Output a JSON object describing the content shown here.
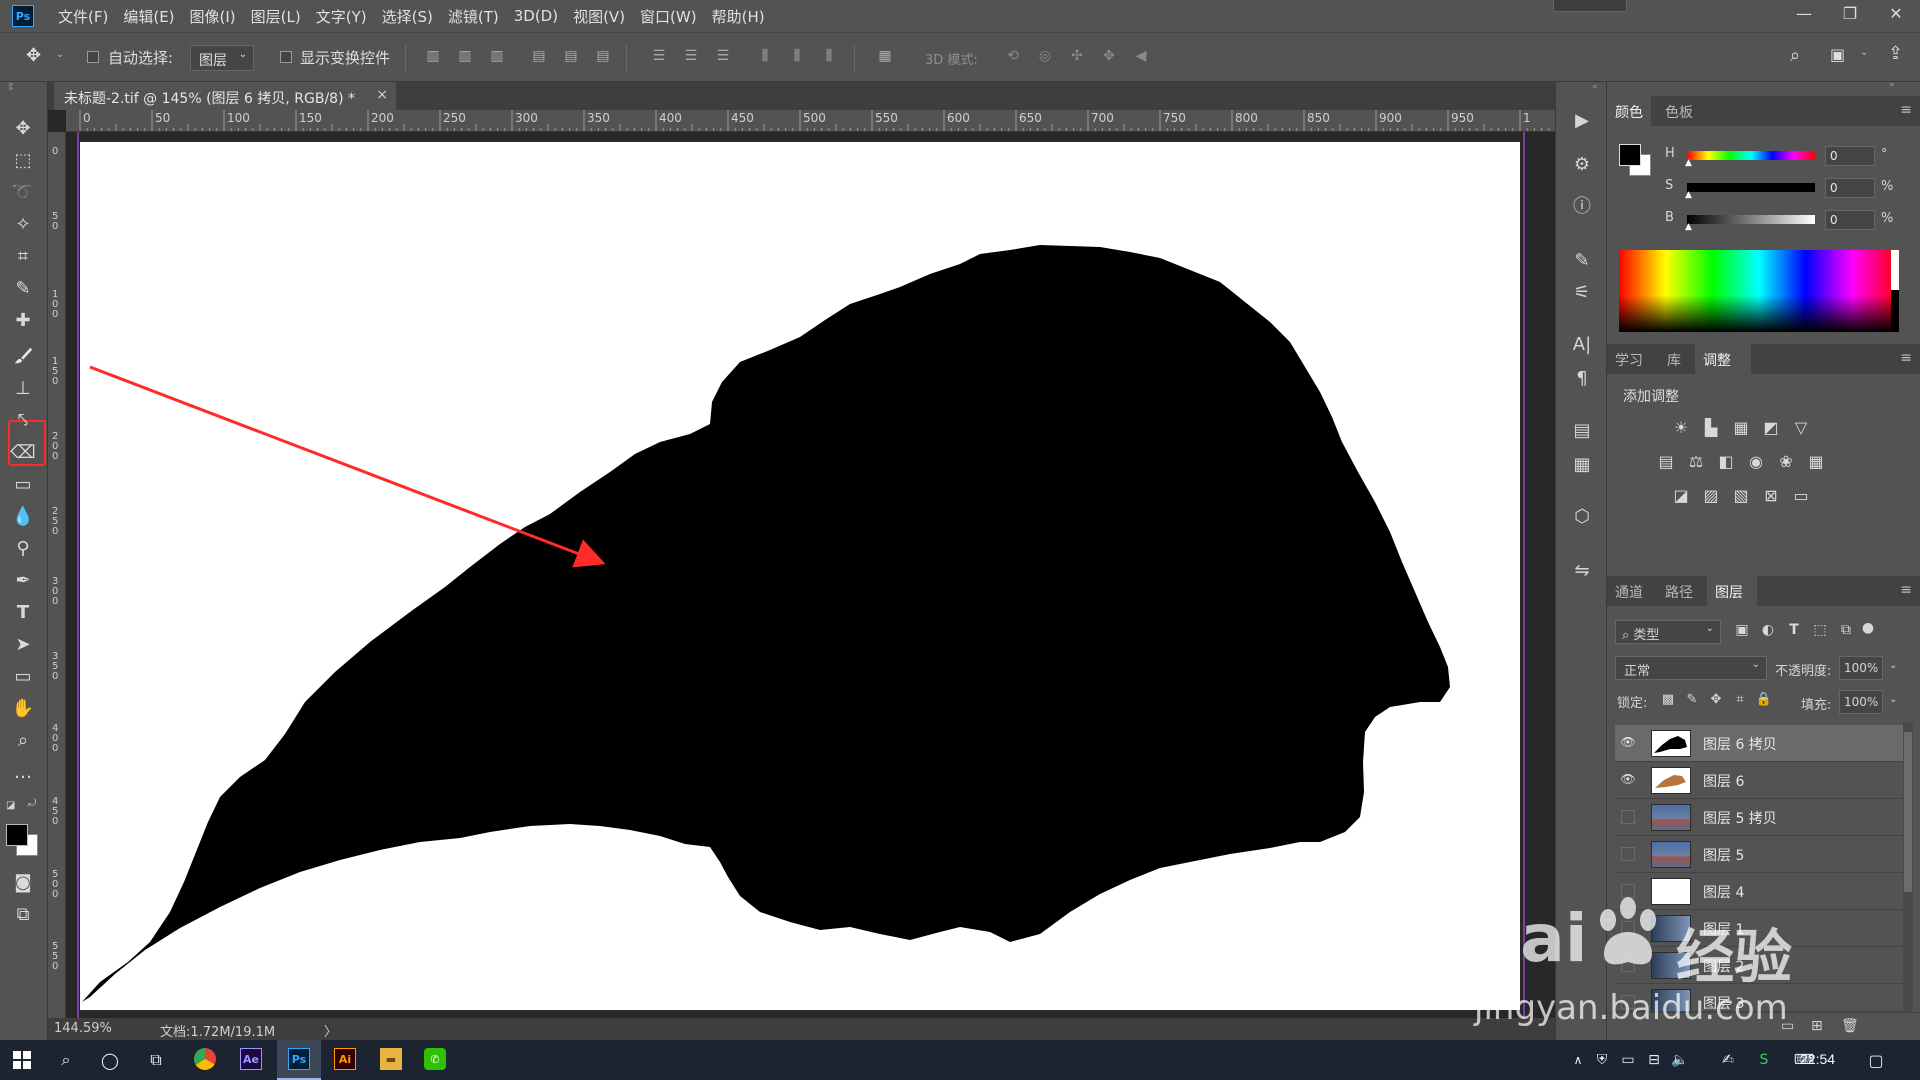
{
  "app": {
    "logo": "Ps"
  },
  "menu": [
    "文件(F)",
    "编辑(E)",
    "图像(I)",
    "图层(L)",
    "文字(Y)",
    "选择(S)",
    "滤镜(T)",
    "3D(D)",
    "视图(V)",
    "窗口(W)",
    "帮助(H)"
  ],
  "options": {
    "auto_select_label": "自动选择:",
    "auto_select_value": "图层",
    "show_transform_label": "显示变换控件",
    "mode3d_label": "3D 模式:"
  },
  "document": {
    "tab_title": "未标题-2.tif @ 145% (图层 6 拷贝, RGB/8) *",
    "close": "×"
  },
  "ruler": {
    "top_ticks": [
      "0",
      "50",
      "100",
      "150",
      "200",
      "250",
      "300",
      "350",
      "400",
      "450",
      "500",
      "550",
      "600",
      "650",
      "700",
      "750",
      "800",
      "850",
      "900",
      "950",
      "1"
    ],
    "left_ticks": [
      "0",
      "5\n0",
      "1\n0\n0",
      "1\n5\n0",
      "2\n0\n0",
      "2\n5\n0",
      "3\n0\n0",
      "3\n5\n0",
      "4\n0\n0",
      "4\n5\n0",
      "5\n0\n0",
      "5\n5\n0"
    ]
  },
  "status": {
    "zoom": "144.59%",
    "doc_info": "文档:1.72M/19.1M",
    "arrow": "〉"
  },
  "color_panel": {
    "tabs": [
      "颜色",
      "色板"
    ],
    "rows": [
      {
        "label": "H",
        "value": "0",
        "unit": "°"
      },
      {
        "label": "S",
        "value": "0",
        "unit": "%"
      },
      {
        "label": "B",
        "value": "0",
        "unit": "%"
      }
    ]
  },
  "adjust_panel": {
    "tabs": [
      "学习",
      "库",
      "调整"
    ],
    "title": "添加调整"
  },
  "layers_panel": {
    "tabs": [
      "通道",
      "路径",
      "图层"
    ],
    "filter_label": "类型",
    "blend_mode": "正常",
    "opacity_label": "不透明度:",
    "opacity_value": "100%",
    "lock_label": "锁定:",
    "fill_label": "填充:",
    "fill_value": "100%",
    "layers": [
      {
        "name": "图层 6 拷贝",
        "visible": true,
        "selected": true,
        "thumb": "black-shape"
      },
      {
        "name": "图层 6",
        "visible": true,
        "selected": false,
        "thumb": "bird"
      },
      {
        "name": "图层 5 拷贝",
        "visible": false,
        "selected": false,
        "thumb": "road"
      },
      {
        "name": "图层 5",
        "visible": false,
        "selected": false,
        "thumb": "road"
      },
      {
        "name": "图层 4",
        "visible": false,
        "selected": false,
        "thumb": "white"
      },
      {
        "name": "图层 1",
        "visible": false,
        "selected": false,
        "thumb": "photo"
      },
      {
        "name": "图层 2",
        "visible": false,
        "selected": false,
        "thumb": "photo"
      },
      {
        "name": "图层 3",
        "visible": false,
        "selected": false,
        "thumb": "photo"
      }
    ]
  },
  "taskbar": {
    "time": "22:54"
  },
  "watermark": {
    "brand": "Bai",
    "brand2": "经验",
    "url": "jingyan.baidu.com"
  },
  "colors": {
    "accent_red": "#ff2a2a",
    "guide_purple": "#7a3fa3",
    "panel": "#535353"
  }
}
